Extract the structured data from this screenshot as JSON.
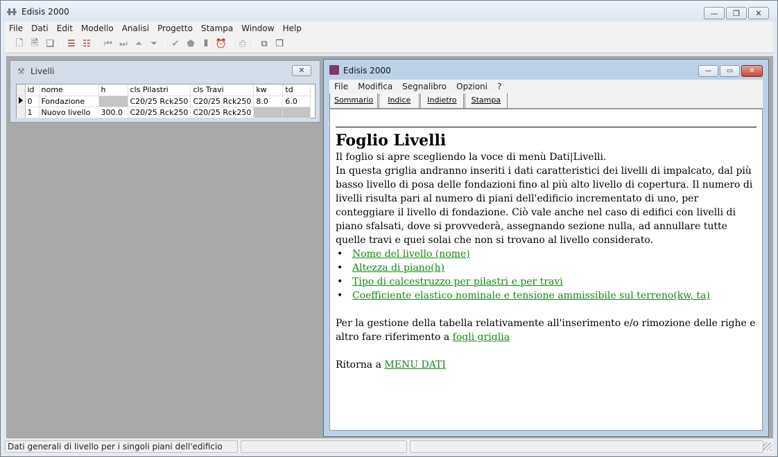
{
  "app": {
    "title": "Edisis 2000"
  },
  "menubar": [
    "File",
    "Dati",
    "Edit",
    "Modello",
    "Analisi",
    "Progetto",
    "Stampa",
    "Window",
    "Help"
  ],
  "livelli": {
    "title": "Livelli",
    "columns": [
      "id",
      "nome",
      "h",
      "cls Pilastri",
      "cls Travi",
      "kw",
      "td"
    ],
    "rows": [
      {
        "id": "0",
        "nome": "Fondazione",
        "h": "",
        "cls_pilastri": "C20/25 Rck250",
        "cls_travi": "C20/25 Rck250",
        "kw": "8.0",
        "td": "6.0"
      },
      {
        "id": "1",
        "nome": "Nuovo livello",
        "h": "300.0",
        "cls_pilastri": "C20/25 Rck250",
        "cls_travi": "C20/25 Rck250",
        "kw": "",
        "td": ""
      }
    ]
  },
  "help": {
    "title": "Edisis 2000",
    "menu": [
      "File",
      "Modifica",
      "Segnalibro",
      "Opzioni",
      "?"
    ],
    "tabs": [
      "Sommario",
      "Indice",
      "Indietro",
      "Stampa"
    ],
    "heading": "Foglio Livelli",
    "intro": "Il foglio si apre scegliendo la voce di menù Dati|Livelli.",
    "body": "In questa griglia andranno inseriti i dati caratteristici dei livelli di impalcato, dal più basso livello di posa delle fondazioni fino al più alto livello di copertura. Il numero di livelli risulta pari al numero di piani dell'edificio incrementato di uno, per conteggiare il livello di fondazione. Ciò vale anche nel caso di edifici con livelli di piano sfalsati, dove si provvederà, assegnando sezione nulla, ad annullare tutte quelle travi e quei solai che non si trovano al livello considerato.",
    "links": [
      "Nome del livello (nome)",
      "Altezza di piano(h)",
      "Tipo di calcestruzzo per pilastri e per travi",
      "Coefficiente elastico nominale e tensione ammissibile sul terreno(kw, ta)"
    ],
    "gestione_text": "Per la gestione della tabella relativamente all'inserimento e/o rimozione delle righe e altro fare riferimento a",
    "gestione_link": "fogli griglia",
    "ritorna_text": "Ritorna a",
    "ritorna_link": "MENU DATI"
  },
  "status": {
    "text": "Dati generali di livello per i singoli piani dell'edificio"
  },
  "icons": {
    "toolbar": [
      "new-icon",
      "open-icon",
      "copy-doc-icon",
      "grid-icon",
      "grid-edit-icon",
      "first-icon",
      "last-icon",
      "top-icon",
      "bottom-icon",
      "check-icon",
      "build-icon",
      "ruler-icon",
      "clock-icon",
      "print-icon",
      "cascade-icon",
      "tile-icon"
    ]
  }
}
